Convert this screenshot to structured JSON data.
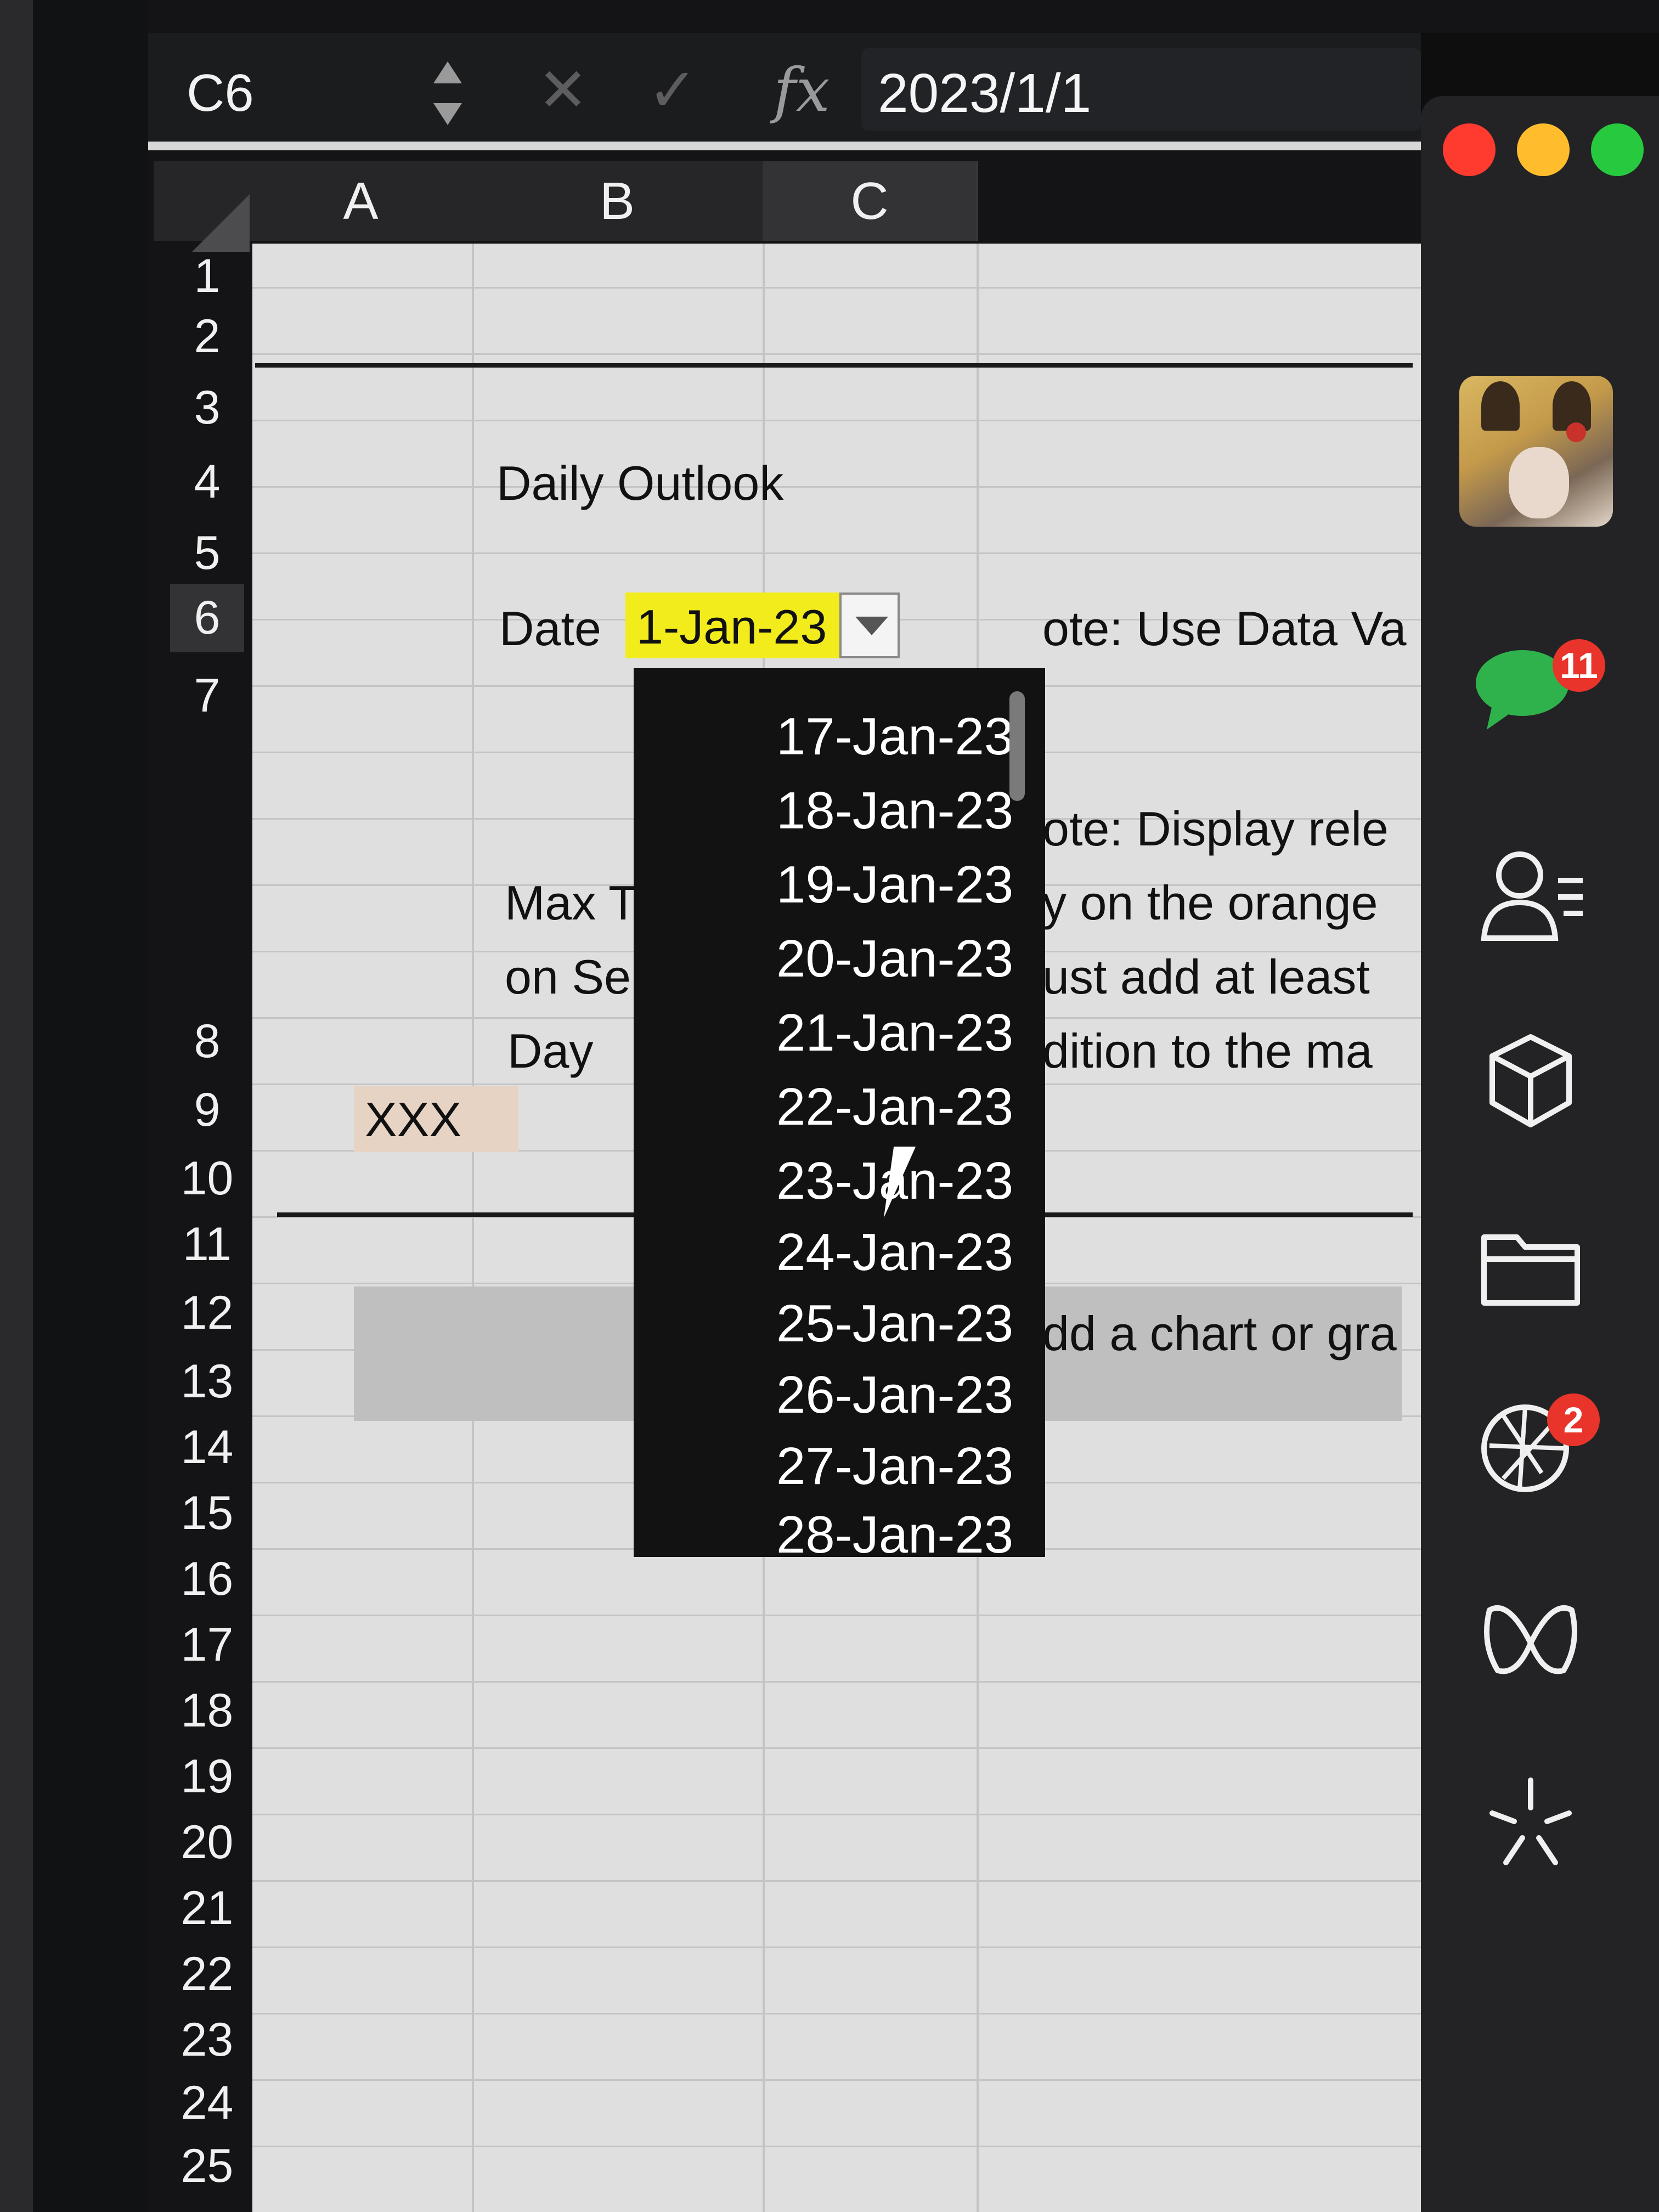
{
  "formula_bar": {
    "name_box": "C6",
    "cancel_icon": "close-icon",
    "confirm_icon": "check-icon",
    "fx_label": "fx",
    "value": "2023/1/1"
  },
  "columns": [
    "A",
    "B",
    "C"
  ],
  "rows": [
    "1",
    "2",
    "3",
    "4",
    "5",
    "6",
    "7",
    "8",
    "9",
    "10",
    "11",
    "12",
    "13",
    "14",
    "15",
    "16",
    "17",
    "18",
    "19",
    "20",
    "21",
    "22",
    "23",
    "24",
    "25"
  ],
  "cells": {
    "b4": "Daily Outlook",
    "b6": "Date",
    "c6": "1-Jan-23",
    "d6": "ote: Use Data Va",
    "b_max_1": "Max T",
    "b_max_2": "on Sel",
    "b8": "Day",
    "b9": "XXX",
    "d_note2_1": "ote: Display rele",
    "d_note2_2": "y on the orange",
    "d_note2_3": "ust add at least",
    "d_note2_4": "dition to the ma",
    "d12": "dd a chart or gra"
  },
  "dropdown": {
    "items": [
      "17-Jan-23",
      "18-Jan-23",
      "19-Jan-23",
      "20-Jan-23",
      "21-Jan-23",
      "22-Jan-23",
      "23-Jan-23",
      "24-Jan-23",
      "25-Jan-23",
      "26-Jan-23",
      "27-Jan-23",
      "28-Jan-23"
    ]
  },
  "dock": {
    "window_controls": [
      "close",
      "minimize",
      "zoom"
    ],
    "messages_badge": "11",
    "camera_badge": "2",
    "icons": [
      "avatar",
      "messages-icon",
      "contacts-icon",
      "cube-icon",
      "folder-icon",
      "aperture-icon",
      "butterfly-icon",
      "sparkle-icon"
    ]
  },
  "colors": {
    "selected_cell": "#f2ec1c",
    "xxx_cell": "#e7d3c4",
    "close": "#ff3b30",
    "minimize": "#ffbd2e",
    "zoom": "#27c93f",
    "badge": "#e8342a"
  }
}
